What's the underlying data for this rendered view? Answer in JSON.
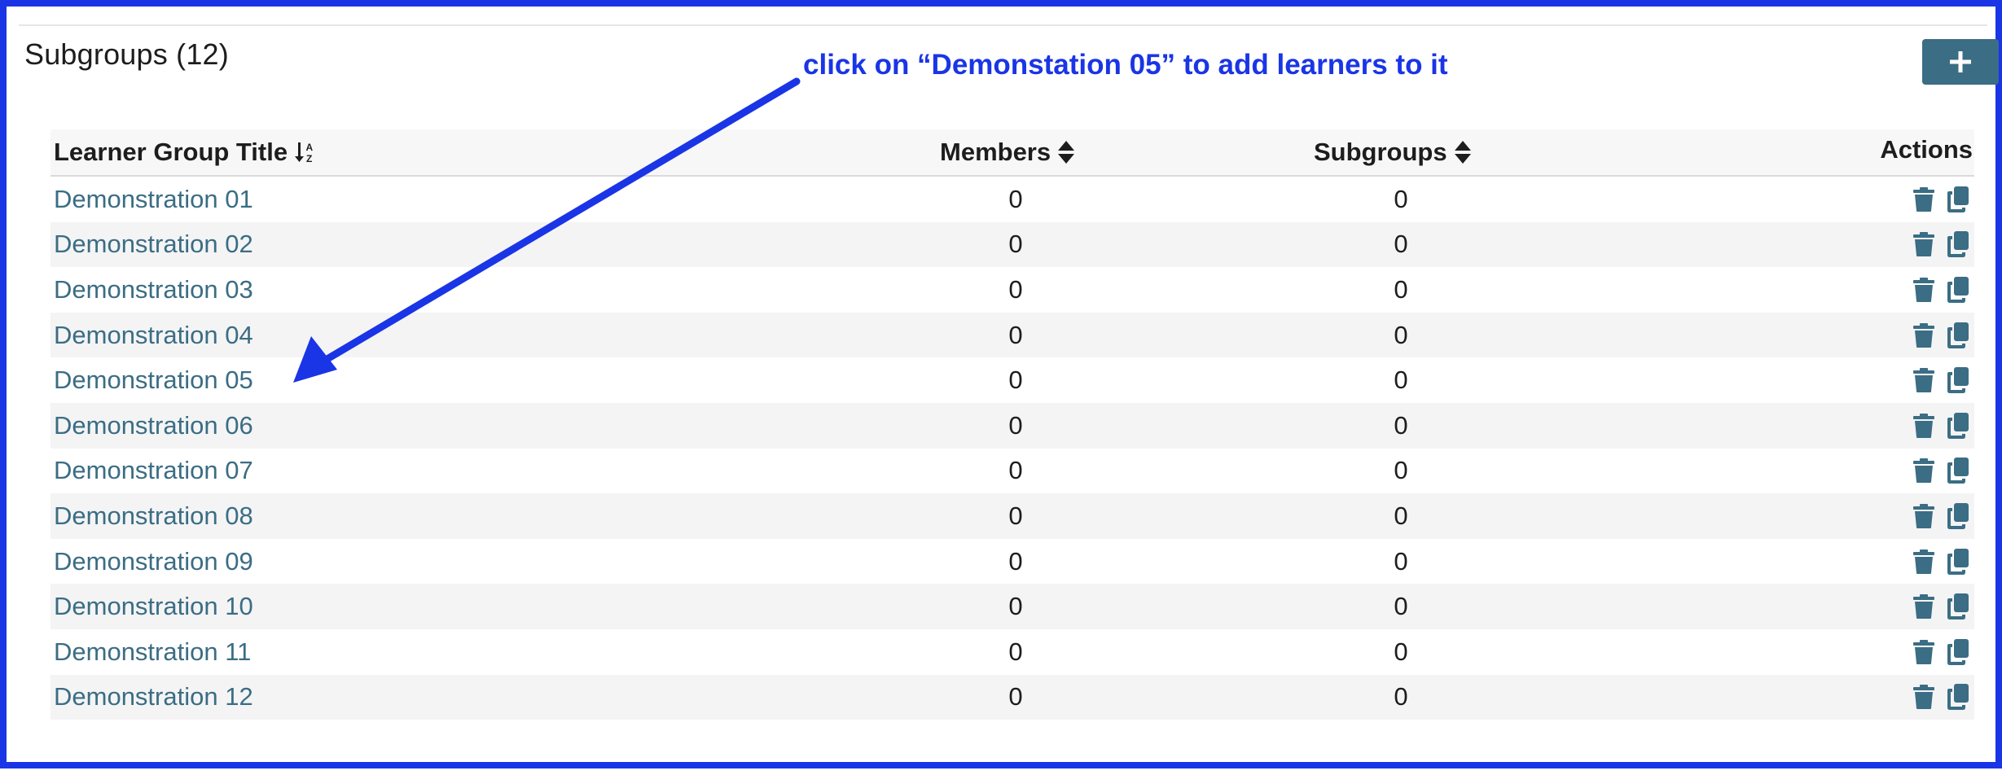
{
  "section": {
    "title": "Subgroups (12)",
    "add_button_icon": "plus-icon"
  },
  "annotation": {
    "text": "click on “Demonstation 05” to add learners to it",
    "color": "#1a35e6"
  },
  "table": {
    "headers": {
      "title": "Learner Group Title",
      "members": "Members",
      "subgroups": "Subgroups",
      "actions": "Actions"
    },
    "rows": [
      {
        "title": "Demonstration 01",
        "members": "0",
        "subgroups": "0"
      },
      {
        "title": "Demonstration 02",
        "members": "0",
        "subgroups": "0"
      },
      {
        "title": "Demonstration 03",
        "members": "0",
        "subgroups": "0"
      },
      {
        "title": "Demonstration 04",
        "members": "0",
        "subgroups": "0"
      },
      {
        "title": "Demonstration 05",
        "members": "0",
        "subgroups": "0"
      },
      {
        "title": "Demonstration 06",
        "members": "0",
        "subgroups": "0"
      },
      {
        "title": "Demonstration 07",
        "members": "0",
        "subgroups": "0"
      },
      {
        "title": "Demonstration 08",
        "members": "0",
        "subgroups": "0"
      },
      {
        "title": "Demonstration 09",
        "members": "0",
        "subgroups": "0"
      },
      {
        "title": "Demonstration 10",
        "members": "0",
        "subgroups": "0"
      },
      {
        "title": "Demonstration 11",
        "members": "0",
        "subgroups": "0"
      },
      {
        "title": "Demonstration 12",
        "members": "0",
        "subgroups": "0"
      }
    ],
    "row_action_icons": [
      "trash-icon",
      "copy-icon"
    ]
  },
  "colors": {
    "accent": "#3b6d84",
    "frame": "#1a35e6",
    "stripe": "#f4f4f5"
  }
}
